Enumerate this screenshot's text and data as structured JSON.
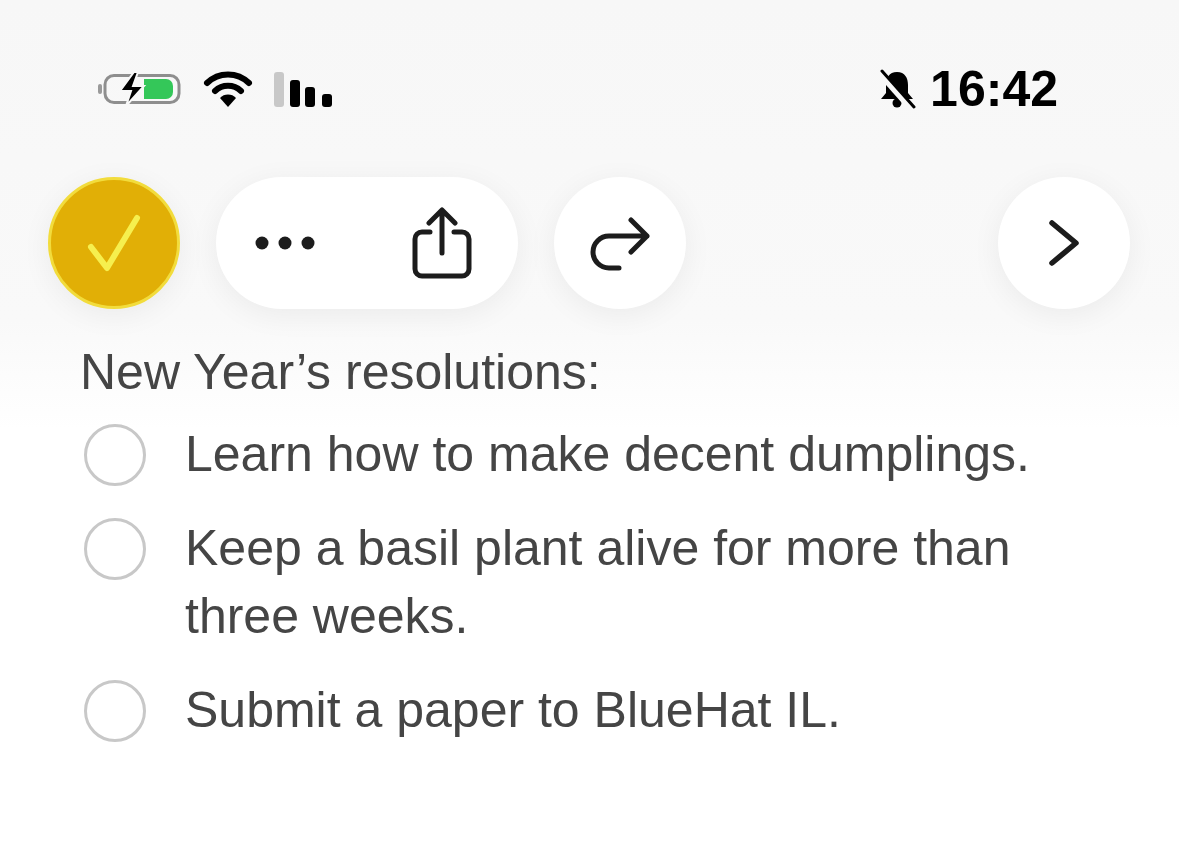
{
  "status_bar": {
    "time": "16:42"
  },
  "note": {
    "heading": "New Year’s resolutions:",
    "checklist": [
      {
        "text": "Learn how to make decent dumplings.",
        "checked": false
      },
      {
        "text": "Keep a basil plant alive for more than three weeks.",
        "checked": false
      },
      {
        "text": "Submit a paper to BlueHat IL.",
        "checked": false
      }
    ]
  }
}
